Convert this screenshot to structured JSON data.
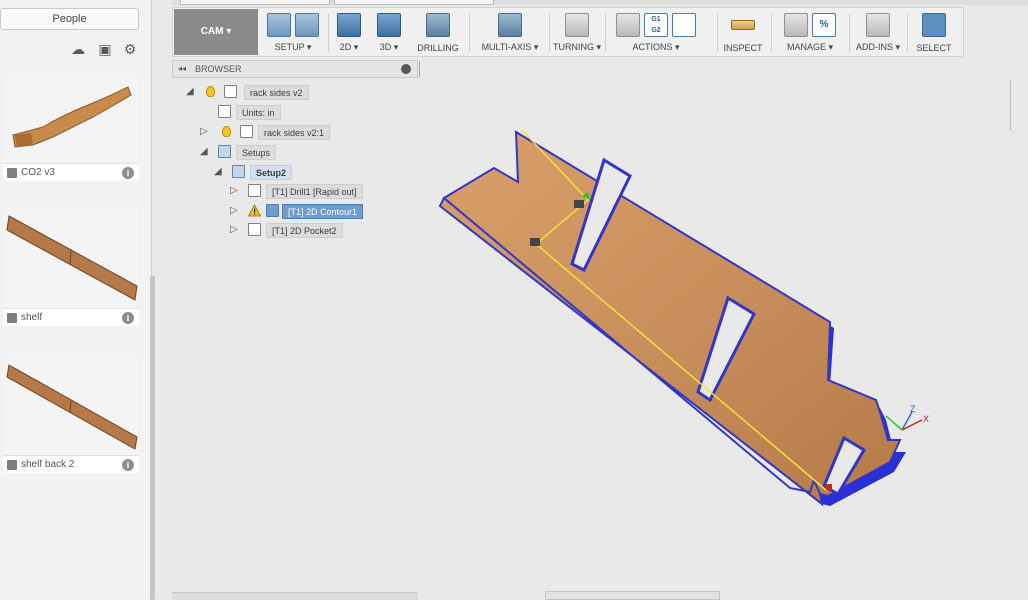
{
  "data_panel": {
    "people_label": "People",
    "tools": [
      "cloud-upload-icon",
      "new-folder-icon",
      "gear-icon"
    ],
    "files": [
      {
        "name": "CO2 v3"
      },
      {
        "name": "shelf"
      },
      {
        "name": "shelf back 2"
      }
    ]
  },
  "toolbar": {
    "workspace_label": "CAM ▾",
    "groups": [
      {
        "label": "SETUP ▾"
      },
      {
        "label": "2D ▾"
      },
      {
        "label": "3D ▾"
      },
      {
        "label": "DRILLING"
      },
      {
        "label": "MULTI-AXIS ▾"
      },
      {
        "label": "TURNING ▾"
      },
      {
        "label": "ACTIONS ▾"
      },
      {
        "label": "INSPECT"
      },
      {
        "label": "MANAGE ▾"
      },
      {
        "label": "ADD-INS ▾"
      },
      {
        "label": "SELECT"
      }
    ],
    "g_codes": [
      "G1",
      "G2"
    ],
    "manage_icon_text": "%"
  },
  "browser": {
    "title": "BROWSER",
    "collapse_glyph": "◂◂",
    "nodes": [
      {
        "label": "rack sides v2"
      },
      {
        "label": "Units: in"
      },
      {
        "label": "rack sides v2:1"
      },
      {
        "label": "Setups"
      },
      {
        "label": "Setup2"
      },
      {
        "label": "[T1] Drill1 [Rapid out]"
      },
      {
        "label": "[T1] 2D Contour1"
      },
      {
        "label": "[T1] 2D Pocket2"
      }
    ]
  },
  "viewport": {
    "axis_labels": {
      "z": "Z",
      "x": "X"
    },
    "colors": {
      "wood": "#c98f5c",
      "edge": "#2b2fd6",
      "toolpath": "#f2e23a"
    }
  }
}
